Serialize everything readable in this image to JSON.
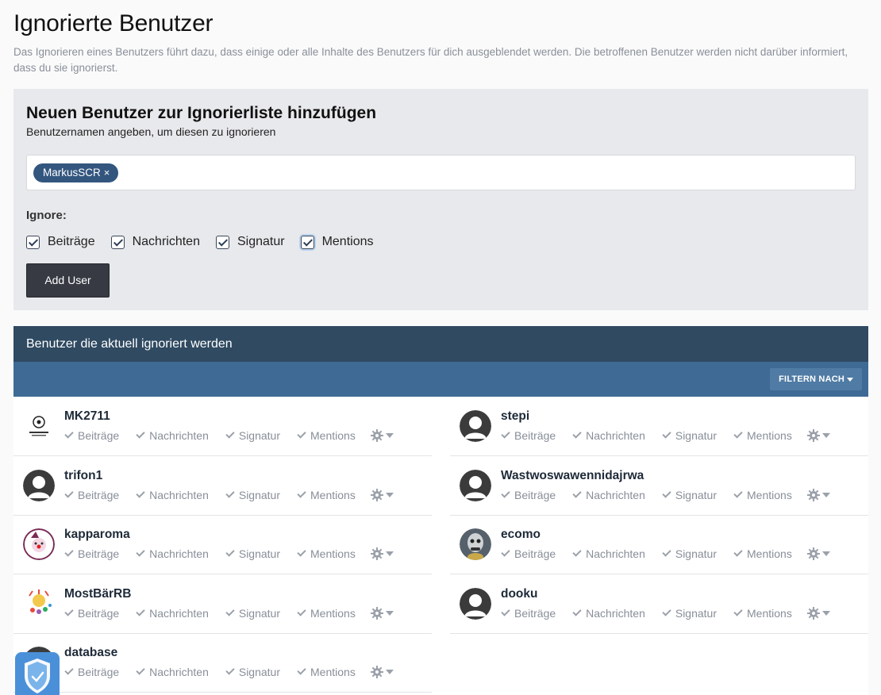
{
  "page": {
    "title": "Ignorierte Benutzer",
    "description": "Das Ignorieren eines Benutzers führt dazu, dass einige oder alle Inhalte des Benutzers für dich ausgeblendet werden. Die betroffenen Benutzer werden nicht darüber informiert, dass du sie ignorierst."
  },
  "add_form": {
    "title": "Neuen Benutzer zur Ignorierliste hinzufügen",
    "subtitle": "Benutzernamen angeben, um diesen zu ignorieren",
    "tag": "MarkusSCR",
    "tag_remove": "×",
    "ignore_label": "Ignore:",
    "checks": [
      "Beiträge",
      "Nachrichten",
      "Signatur",
      "Mentions"
    ],
    "button": "Add User"
  },
  "list": {
    "header": "Benutzer die aktuell ignoriert werden",
    "filter": "FILTERN NACH",
    "option_labels": [
      "Beiträge",
      "Nachrichten",
      "Signatur",
      "Mentions"
    ],
    "users": [
      {
        "name": "MK2711",
        "avatar": "champions-league-icon"
      },
      {
        "name": "stepi",
        "avatar": "default-avatar-icon"
      },
      {
        "name": "trifon1",
        "avatar": "default-avatar-icon"
      },
      {
        "name": "Wastwoswawennidajrwa",
        "avatar": "default-avatar-icon"
      },
      {
        "name": "kapparoma",
        "avatar": "clown-logo-icon"
      },
      {
        "name": "ecomo",
        "avatar": "photo-avatar-icon"
      },
      {
        "name": "MostBärRB",
        "avatar": "colorful-avatar-icon"
      },
      {
        "name": "dooku",
        "avatar": "default-avatar-icon"
      },
      {
        "name": "database",
        "avatar": "default-avatar-icon"
      }
    ]
  },
  "colors": {
    "list_header": "#2f4a61",
    "filter_bar": "#3e6a95",
    "tag": "#33567f",
    "button": "#373a43",
    "shield": "#4a90d9"
  }
}
